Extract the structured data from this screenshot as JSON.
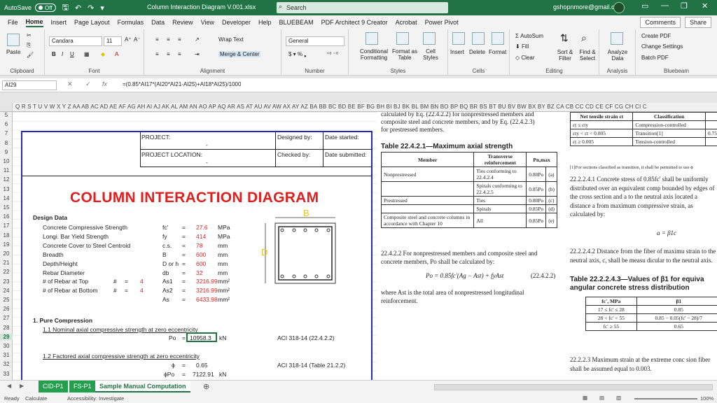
{
  "titlebar": {
    "autosave": "AutoSave",
    "toggle": "Off",
    "filename": "Column Interaction Diagram V.001.xlsx",
    "search": "Search",
    "email": "gshopnmore@gmail.com"
  },
  "menu": [
    "File",
    "Home",
    "Insert",
    "Page Layout",
    "Formulas",
    "Data",
    "Review",
    "View",
    "Developer",
    "Help",
    "BLUEBEAM",
    "PDF Architect 9 Creator",
    "Acrobat",
    "Power Pivot"
  ],
  "share": {
    "comments": "Comments",
    "share": "Share"
  },
  "ribbon": {
    "clipboard": {
      "label": "Clipboard",
      "paste": "Paste"
    },
    "font": {
      "label": "Font",
      "name": "Candara",
      "size": "11"
    },
    "alignment": {
      "label": "Alignment",
      "wrap": "Wrap Text",
      "merge": "Merge & Center"
    },
    "number": {
      "label": "Number",
      "format": "General"
    },
    "styles": {
      "label": "Styles",
      "cond": "Conditional Formatting",
      "table": "Format as Table",
      "cell": "Cell Styles"
    },
    "cells": {
      "label": "Cells",
      "insert": "Insert",
      "delete": "Delete",
      "format": "Format"
    },
    "editing": {
      "label": "Editing",
      "autosum": "AutoSum",
      "fill": "Fill",
      "clear": "Clear",
      "sort": "Sort & Filter",
      "find": "Find & Select"
    },
    "analysis": {
      "label": "Analysis",
      "analyze": "Analyze Data"
    },
    "bluebeam": {
      "label": "Bluebeam",
      "create": "Create PDF",
      "change": "Change Settings",
      "batch": "Batch PDF"
    }
  },
  "formulabar": {
    "namebox": "AI29",
    "formula": "=(0.85*AI17*(AI20*AI21-AI25)+AI18*AI25)/1000"
  },
  "columns": "Q R S T U V W X Y Z AA AB AC AD AE AF AG AH AI AJ AK AL AM AN AO AP AQ AR AS AT AU AV AW AX AY AZ BA BB BC BD BE BF BG BH BI BJ BK BL BM BN BO BP BQ BR BS BT BU BV BW BX BY BZ CA CB CC CD CE CF CG CH CI C",
  "rows": [
    "5",
    "6",
    "7",
    "8",
    "9",
    "10",
    "11",
    "12",
    "13",
    "14",
    "15",
    "16",
    "17",
    "18",
    "19",
    "20",
    "21",
    "22",
    "23",
    "24",
    "25",
    "26",
    "27",
    "28",
    "29",
    "30",
    "31",
    "32",
    "33"
  ],
  "sheet": {
    "project": "PROJECT:",
    "project_val": "-",
    "location": "PROJECT LOCATION:",
    "location_val": "-",
    "designed": "Designed by:",
    "checked": "Checked by:",
    "started": "Date started:",
    "submitted": "Date submitted:",
    "title": "COLUMN INTERACTION DIAGRAM",
    "design_data": "Design Data",
    "params": [
      {
        "name": "Concrete Compressive Strength",
        "sym": "fc'",
        "eq": "=",
        "val": "27.6",
        "unit": "MPa"
      },
      {
        "name": "Longi. Bar Yield Strength",
        "sym": "fy",
        "eq": "=",
        "val": "414",
        "unit": "MPa"
      },
      {
        "name": "Concrete Cover to Steel Centroid",
        "sym": "c.s.",
        "eq": "=",
        "val": "78",
        "unit": "mm"
      },
      {
        "name": "Breadth",
        "sym": "B",
        "eq": "=",
        "val": "600",
        "unit": "mm"
      },
      {
        "name": "Depth/Height",
        "sym": "D or h",
        "eq": "=",
        "val": "600",
        "unit": "mm"
      },
      {
        "name": "Rebar Diameter",
        "sym": "db",
        "eq": "=",
        "val": "32",
        "unit": "mm"
      },
      {
        "name": "# of Rebar at Top",
        "pre": "#",
        "preeq": "=",
        "prev": "4",
        "sym": "As1",
        "eq": "=",
        "val": "3216.99",
        "unit": "mm²"
      },
      {
        "name": "# of Rebar at Bottom",
        "pre": "#",
        "preeq": "=",
        "prev": "4",
        "sym": "As2",
        "eq": "=",
        "val": "3216.99",
        "unit": "mm²"
      },
      {
        "name": "",
        "sym": "As",
        "eq": "=",
        "val": "6433.98",
        "unit": "mm²"
      }
    ],
    "dim_b": "B",
    "dim_d": "D",
    "s1": "1. Pure Compression",
    "s11": "1.1 Nominal axial compressive strength at zero eccentricity",
    "po": {
      "sym": "Po",
      "eq": "=",
      "val": "10958.3",
      "unit": "kN",
      "ref": "ACI 318-14 (22.4.2.2)"
    },
    "s12": "1.2 Factored axial compressive strength at zero eccentricity",
    "phi": {
      "sym": "ϕ",
      "eq": "=",
      "val": "0.65",
      "ref": "ACI 318-14 (Table 21.2.2)"
    },
    "phipo": {
      "sym": "ϕPo",
      "eq": "=",
      "val": "7122.91",
      "unit": "kN"
    }
  },
  "ref1": {
    "top": "calculated by Eq. (22.4.2.2) for nonprestressed members and",
    "top2": "composite steel and concrete members, and by Eq. (22.4.2.3)",
    "top3": "for prestressed members.",
    "table_title": "Table 22.4.2.1—Maximum axial strength",
    "h_member": "Member",
    "h_trans": "Transverse reinforcement",
    "h_pn": "Pn,max",
    "rows": [
      {
        "m": "Nonprestressed",
        "t": "Ties conforming to 22.4.2.4",
        "p": "0.80Po",
        "e": "(a)"
      },
      {
        "m": "",
        "t": "Spirals conforming to 22.4.2.5",
        "p": "0.85Po",
        "e": "(b)"
      },
      {
        "m": "Prestressed",
        "t": "Ties",
        "p": "0.80Po",
        "e": "(c)"
      },
      {
        "m": "",
        "t": "Spirals",
        "p": "0.85Po",
        "e": "(d)"
      },
      {
        "m": "Composite steel and concrete columns in accordance with Chapter 10",
        "t": "All",
        "p": "0.85Po",
        "e": "(e)"
      }
    ],
    "p1": "22.4.2.2 For nonprestressed members and composite steel and concrete members, Po shall be calculated by:",
    "eq": "Po = 0.85fc'(Ag − Ast) + fyAst",
    "eqno": "(22.4.2.2)",
    "p2": "where Ast is the total area of nonprestressed longitudinal reinforcement."
  },
  "ref2": {
    "h1": "Net tensile strain εt",
    "h2": "Classification",
    "r1a": "εt ≤ εty",
    "r1b": "Compression-controlled",
    "r2a": "εty < εt < 0.005",
    "r2b": "Transition[1]",
    "r2c": "0.75",
    "r3a": "εt ≥ 0.005",
    "r3b": "Tension-controlled",
    "fn": "[1]For sections classified as transition, it shall be permitted to use ϕ",
    "p1": "22.2.2.4.1 Concrete stress of 0.85fc' shall be uniformly distributed over an equivalent comp bounded by edges of the cross section and a to the neutral axis located a distance a from maximum compressive strain, as calculated by:",
    "eq": "a = β1c",
    "p2": "22.2.2.4.2 Distance from the fiber of maximu strain to the neutral axis, c, shall be measu dicular to the neutral axis.",
    "ttl": "Table 22.2.2.4.3—Values of β1 for equiva angular concrete stress distribution",
    "th1": "fc', MPa",
    "th2": "β1",
    "rows": [
      {
        "a": "17 ≤ fc' ≤ 28",
        "b": "0.85"
      },
      {
        "a": "28 < fc' < 55",
        "b": "0.85 − 0.05(fc' − 28)/7"
      },
      {
        "a": "fc' ≥ 55",
        "b": "0.65"
      }
    ],
    "p3": "22.2.2.3 Maximum strain at the extreme conc sion fiber shall be assumed equal to 0.003."
  },
  "tabs": [
    "CID-P1",
    "FS-P1",
    "Sample Manual Computation"
  ],
  "status": {
    "ready": "Ready",
    "calc": "Calculate",
    "access": "Accessibility: Investigate",
    "zoom": "100%"
  }
}
